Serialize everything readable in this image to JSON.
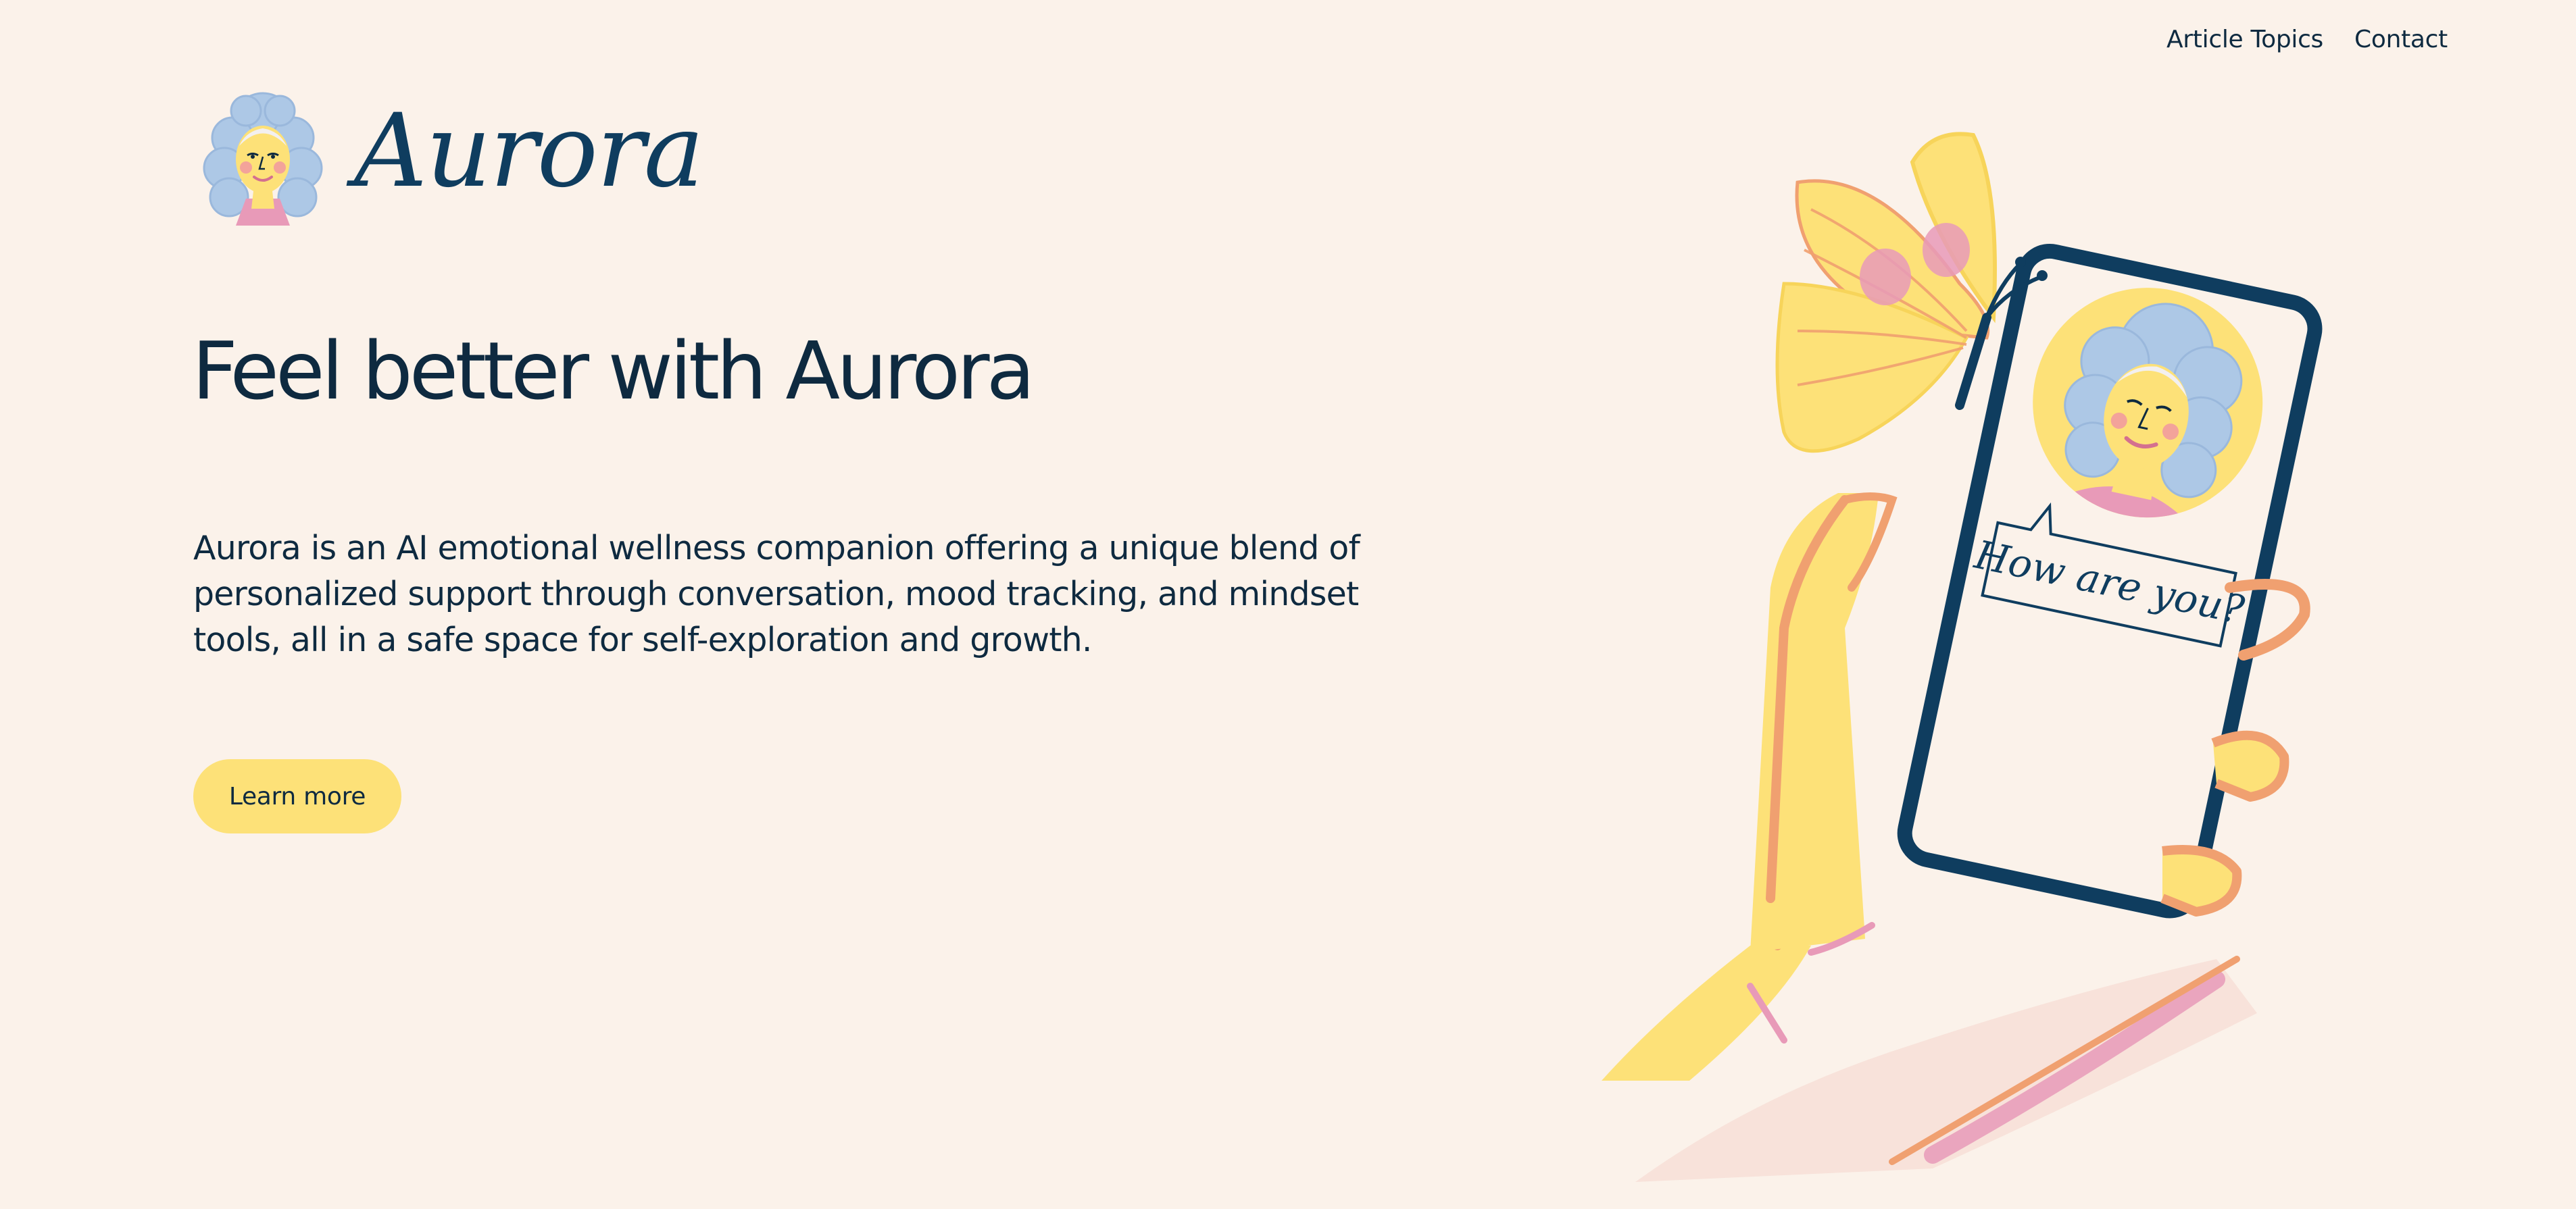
{
  "nav": {
    "items": [
      "Article Topics",
      "Contact"
    ]
  },
  "brand": {
    "name": "Aurora"
  },
  "hero": {
    "title": "Feel better with Aurora",
    "description": "Aurora is an AI emotional wellness companion offering a unique blend of personalized support through conversation, mood tracking, and mindset tools, all in a safe space for self-exploration and growth.",
    "cta_label": "Learn more"
  },
  "illustration": {
    "speech_text": "How are you?"
  },
  "colors": {
    "background": "#fbf2ea",
    "text": "#0e2a40",
    "accent_yellow": "#fde178",
    "phone_navy": "#0f3d5f",
    "skin_orange": "#f0a070",
    "pink": "#e89ab8",
    "hair_blue": "#adc8e6"
  },
  "icons": {
    "logo": "woman-avatar-icon",
    "illustration": "hand-holding-phone-with-butterfly"
  }
}
